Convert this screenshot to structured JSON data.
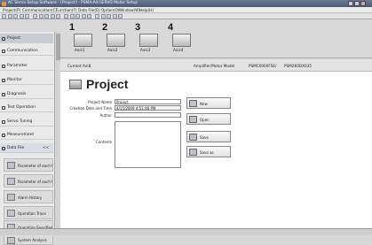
{
  "window": {
    "title": "AC Servo Setup Software - [Project] - PSMA-AX-SERVO Motor Setup",
    "min_label": "_",
    "max_label": "□",
    "close_label": "×"
  },
  "menu": [
    "Project(P)",
    "Communication(C)",
    "Function(F)",
    "Data File(D)",
    "Option(O)",
    "Window(W)",
    "Help(H)"
  ],
  "axes": [
    {
      "number": "1",
      "label": "Axis1"
    },
    {
      "number": "2",
      "label": "Axis2"
    },
    {
      "number": "3",
      "label": "Axis3"
    },
    {
      "number": "4",
      "label": "Axis4"
    }
  ],
  "sidebar": {
    "items": [
      {
        "label": "Project",
        "icon": "folder-icon"
      },
      {
        "label": "Communication",
        "icon": "communication-icon"
      },
      {
        "label": "Parameter",
        "icon": "parameter-icon"
      },
      {
        "label": "Monitor",
        "icon": "monitor-icon"
      },
      {
        "label": "Diagnosis",
        "icon": "search-icon"
      },
      {
        "label": "Test Operation",
        "icon": "test-icon"
      },
      {
        "label": "Servo Tuning",
        "icon": "tuning-icon"
      },
      {
        "label": "Measurement",
        "icon": "measurement-icon"
      },
      {
        "label": "Data File",
        "icon": "file-icon",
        "collapse": "<<"
      }
    ],
    "subitems": [
      {
        "label": "Parameter of each t"
      },
      {
        "label": "Parameter of each t"
      },
      {
        "label": "Alarm History"
      },
      {
        "label": "Operation Trace"
      },
      {
        "label": "Operation Specified"
      },
      {
        "label": "System Analysis"
      }
    ]
  },
  "infobar": {
    "current_axis_label": "Current Axis",
    "current_axis_value": "1",
    "amp_label": "Amplifier/Motor Model",
    "amp_value": "PSMC0000FSE",
    "separator": "/",
    "motor_value": "PSM2K0DX035"
  },
  "page_title": "Project",
  "fields": [
    {
      "label": "Project Name",
      "value": "Project"
    },
    {
      "label": "Creation Date and Time",
      "value": "4/15/2009 4:51:48 PM"
    },
    {
      "label": "Author",
      "value": ""
    },
    {
      "label": "Contents",
      "value": ""
    }
  ],
  "buttons": [
    {
      "label": "New"
    },
    {
      "label": "Open"
    },
    {
      "label": "Save"
    },
    {
      "label": "Save as"
    }
  ]
}
